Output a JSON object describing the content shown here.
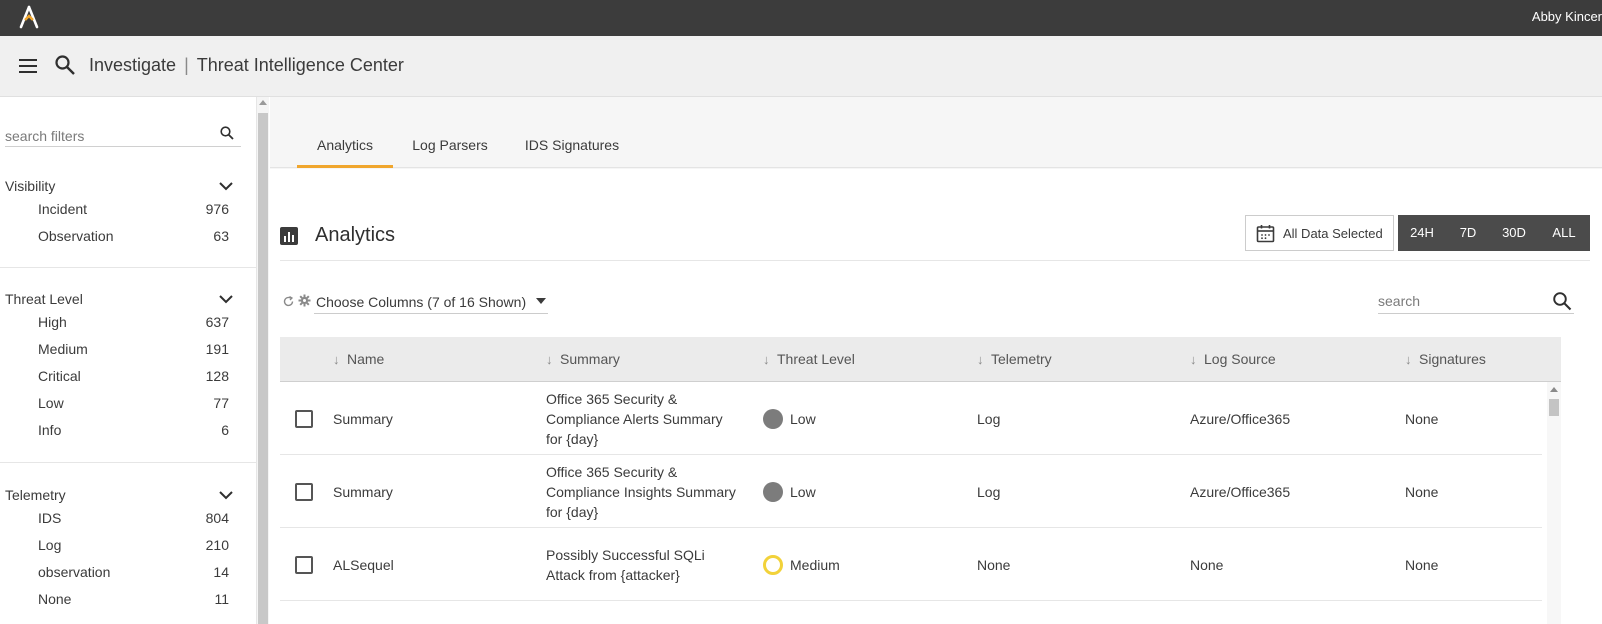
{
  "app": {
    "user_name": "Abby Kincer"
  },
  "header": {
    "section": "Investigate",
    "separator": "|",
    "page": "Threat Intelligence Center"
  },
  "sidebar": {
    "search_placeholder": "search filters",
    "groups": [
      {
        "label": "Visibility",
        "items": [
          {
            "label": "Incident",
            "count": "976"
          },
          {
            "label": "Observation",
            "count": "63"
          }
        ]
      },
      {
        "label": "Threat Level",
        "items": [
          {
            "label": "High",
            "count": "637"
          },
          {
            "label": "Medium",
            "count": "191"
          },
          {
            "label": "Critical",
            "count": "128"
          },
          {
            "label": "Low",
            "count": "77"
          },
          {
            "label": "Info",
            "count": "6"
          }
        ]
      },
      {
        "label": "Telemetry",
        "items": [
          {
            "label": "IDS",
            "count": "804"
          },
          {
            "label": "Log",
            "count": "210"
          },
          {
            "label": "observation",
            "count": "14"
          },
          {
            "label": "None",
            "count": "11"
          }
        ]
      }
    ]
  },
  "tabs": [
    {
      "label": "Analytics",
      "active": true
    },
    {
      "label": "Log Parsers",
      "active": false
    },
    {
      "label": "IDS Signatures",
      "active": false
    }
  ],
  "analytics": {
    "title": "Analytics",
    "date_filter": "All Data Selected",
    "ranges": [
      "24H",
      "7D",
      "30D",
      "ALL"
    ],
    "choose_columns": "Choose Columns (7 of 16 Shown)",
    "search_placeholder": "search"
  },
  "table": {
    "columns": [
      "Name",
      "Summary",
      "Threat Level",
      "Telemetry",
      "Log Source",
      "Signatures"
    ],
    "rows": [
      {
        "name": "Summary",
        "summary_lines": [
          "Office 365 Security &",
          "Compliance Alerts Summary",
          "for {day}"
        ],
        "threat_level": "Low",
        "telemetry": "Log",
        "log_source": "Azure/Office365",
        "signatures": "None"
      },
      {
        "name": "Summary",
        "summary_lines": [
          "Office 365 Security &",
          "Compliance Insights Summary",
          "for {day}"
        ],
        "threat_level": "Low",
        "telemetry": "Log",
        "log_source": "Azure/Office365",
        "signatures": "None"
      },
      {
        "name": "ALSequel",
        "summary_lines": [
          "Possibly Successful SQLi",
          "Attack from {attacker}"
        ],
        "threat_level": "Medium",
        "telemetry": "None",
        "log_source": "None",
        "signatures": "None"
      }
    ]
  },
  "colors": {
    "topbar": "#3c3c3c",
    "accent_tab": "#f0a62d",
    "low_dot": "#7c7c7c",
    "medium_ring": "#f2d23a",
    "range_group": "#4b4b4b"
  }
}
